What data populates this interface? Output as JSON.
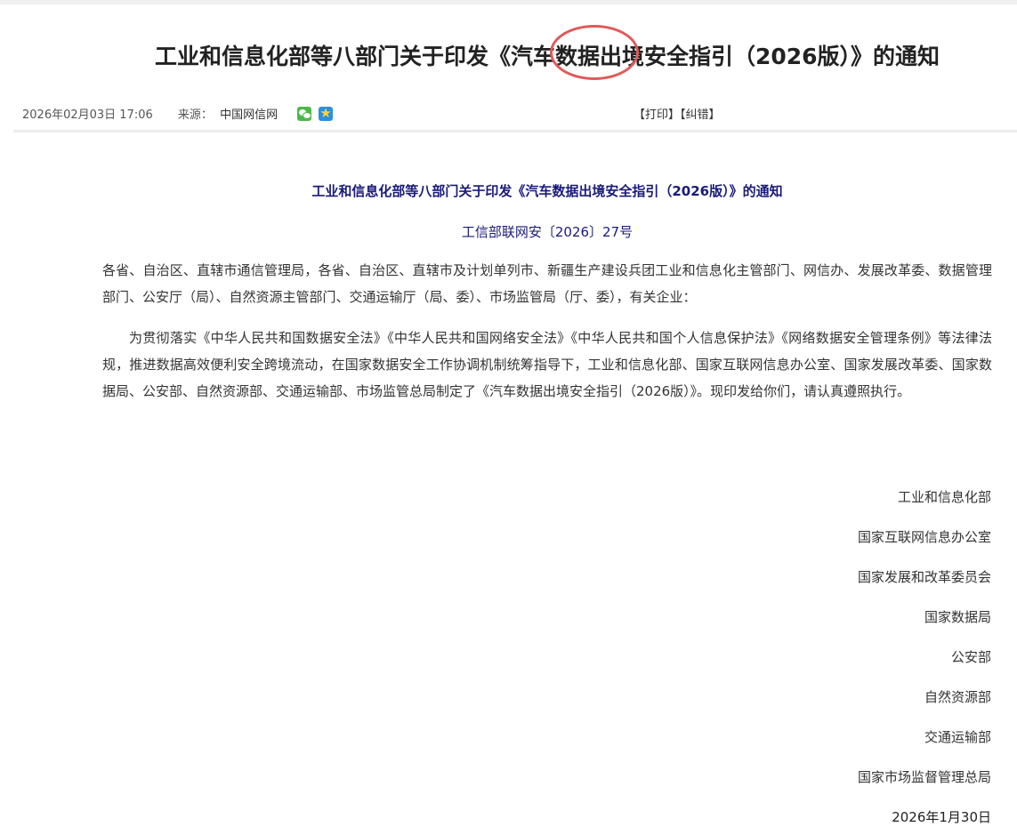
{
  "article": {
    "title": "工业和信息化部等八部门关于印发《汽车数据出境安全指引（2026版）》的通知"
  },
  "meta": {
    "date": "2026年02月03日 17:06",
    "source_label": "来源：",
    "source_name": "中国网信网",
    "share_icons": [
      "wechat-icon",
      "qzone-icon"
    ]
  },
  "tools": {
    "print": "【打印】",
    "correct": "【纠错】"
  },
  "document": {
    "title": "工业和信息化部等八部门关于印发《汽车数据出境安全指引（2026版）》的通知",
    "number": "工信部联网安〔2026〕27号",
    "addressees": "各省、自治区、直辖市通信管理局，各省、自治区、直辖市及计划单列市、新疆生产建设兵团工业和信息化主管部门、网信办、发展改革委、数据管理部门、公安厅（局）、自然资源主管部门、交通运输厅（局、委）、市场监管局（厅、委），有关企业：",
    "body": "为贯彻落实《中华人民共和国数据安全法》《中华人民共和国网络安全法》《中华人民共和国个人信息保护法》《网络数据安全管理条例》等法律法规，推进数据高效便利安全跨境流动，在国家数据安全工作协调机制统筹指导下，工业和信息化部、国家互联网信息办公室、国家发展改革委、国家数据局、公安部、自然资源部、交通运输部、市场监管总局制定了《汽车数据出境安全指引（2026版）》。现印发给你们，请认真遵照执行。",
    "signatories": [
      "工业和信息化部",
      "国家互联网信息办公室",
      "国家发展和改革委员会",
      "国家数据局",
      "公安部",
      "自然资源部",
      "交通运输部",
      "国家市场监督管理总局"
    ],
    "sign_date": "2026年1月30日"
  },
  "colors": {
    "doc_title": "#1a1a7a",
    "highlight_circle": "#e05a5a",
    "wechat": "#4cb848",
    "qzone": "#2a8fe0"
  }
}
